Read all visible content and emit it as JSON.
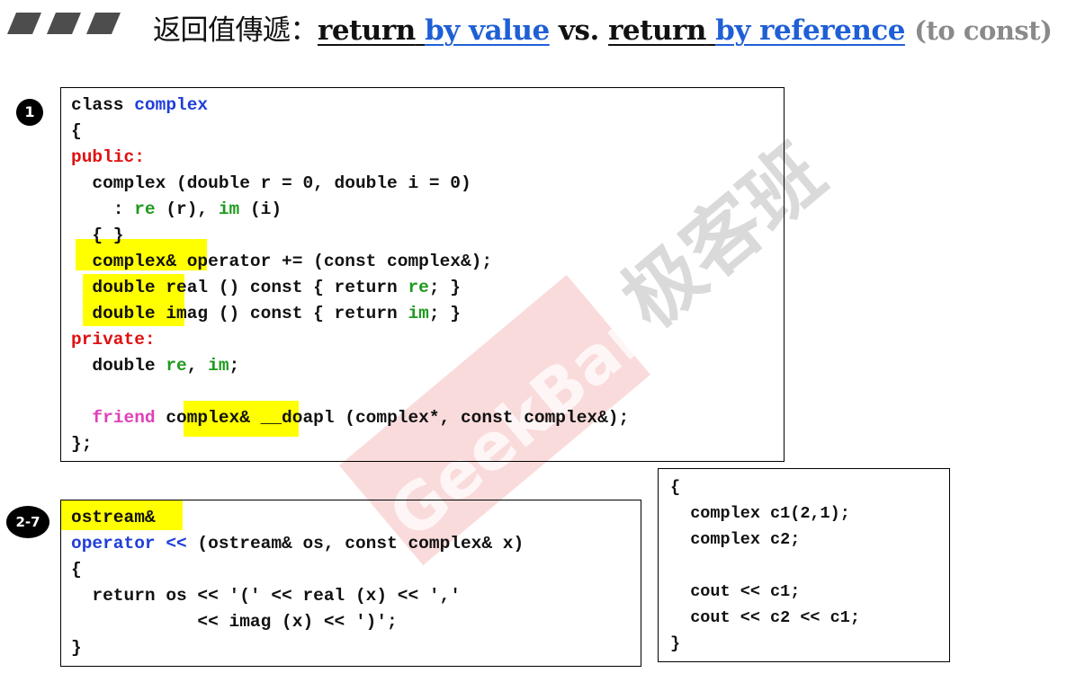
{
  "title": {
    "prefix": "返回值傳遞：",
    "return1": "return",
    "by_value": "by value",
    "vs": "vs.",
    "return2": "return",
    "by_reference": "by reference",
    "suffix": "(to const)"
  },
  "badges": {
    "first": "1",
    "second": "2-7"
  },
  "watermark": {
    "brand": "GeekBand",
    "cjk": "极客班"
  },
  "colors": {
    "highlight": "#ffff00",
    "keyword_blue": "#1f3ed8",
    "access_red": "#e01010",
    "member_green": "#1e9a1e",
    "friend_pink": "#e040b8",
    "title_blue": "#1f5fd6"
  },
  "code_block_1": {
    "lines": [
      {
        "segments": [
          {
            "t": "class "
          },
          {
            "t": "complex",
            "c": "blue"
          }
        ]
      },
      {
        "segments": [
          {
            "t": "{"
          }
        ]
      },
      {
        "segments": [
          {
            "t": "public:",
            "c": "red"
          }
        ]
      },
      {
        "segments": [
          {
            "t": "  complex (double r = 0, double i = 0)"
          }
        ]
      },
      {
        "segments": [
          {
            "t": "    : "
          },
          {
            "t": "re",
            "c": "green"
          },
          {
            "t": " (r), "
          },
          {
            "t": "im",
            "c": "green"
          },
          {
            "t": " (i)"
          }
        ]
      },
      {
        "segments": [
          {
            "t": "  { }"
          }
        ]
      },
      {
        "segments": [
          {
            "t": "  complex& operator += (const complex&);"
          }
        ]
      },
      {
        "segments": [
          {
            "t": "  double real () const { return "
          },
          {
            "t": "re",
            "c": "green"
          },
          {
            "t": "; }"
          }
        ]
      },
      {
        "segments": [
          {
            "t": "  double imag () const { return "
          },
          {
            "t": "im",
            "c": "green"
          },
          {
            "t": "; }"
          }
        ]
      },
      {
        "segments": [
          {
            "t": "private:",
            "c": "red"
          }
        ]
      },
      {
        "segments": [
          {
            "t": "  double "
          },
          {
            "t": "re",
            "c": "green"
          },
          {
            "t": ", "
          },
          {
            "t": "im",
            "c": "green"
          },
          {
            "t": ";"
          }
        ]
      },
      {
        "segments": [
          {
            "t": ""
          }
        ]
      },
      {
        "segments": [
          {
            "t": "  "
          },
          {
            "t": "friend",
            "c": "pink"
          },
          {
            "t": " complex& __doapl (complex*, const complex&);"
          }
        ]
      },
      {
        "segments": [
          {
            "t": "};"
          }
        ]
      }
    ]
  },
  "code_block_2": {
    "lines": [
      {
        "segments": [
          {
            "t": "ostream&"
          }
        ]
      },
      {
        "segments": [
          {
            "t": "operator <<",
            "c": "blue"
          },
          {
            "t": " (ostream& os, const complex& x)"
          }
        ]
      },
      {
        "segments": [
          {
            "t": "{"
          }
        ]
      },
      {
        "segments": [
          {
            "t": "  return os << '(' << real (x) << ','"
          }
        ]
      },
      {
        "segments": [
          {
            "t": "            << imag (x) << ')';"
          }
        ]
      },
      {
        "segments": [
          {
            "t": "}"
          }
        ]
      }
    ]
  },
  "code_block_3": {
    "lines": [
      {
        "segments": [
          {
            "t": "{"
          }
        ]
      },
      {
        "segments": [
          {
            "t": "  complex c1(2,1);"
          }
        ]
      },
      {
        "segments": [
          {
            "t": "  complex c2;"
          }
        ]
      },
      {
        "segments": [
          {
            "t": ""
          }
        ]
      },
      {
        "segments": [
          {
            "t": "  cout << c1;"
          }
        ]
      },
      {
        "segments": [
          {
            "t": "  cout << c2 << c1;"
          }
        ]
      },
      {
        "segments": [
          {
            "t": "}"
          }
        ]
      }
    ]
  }
}
